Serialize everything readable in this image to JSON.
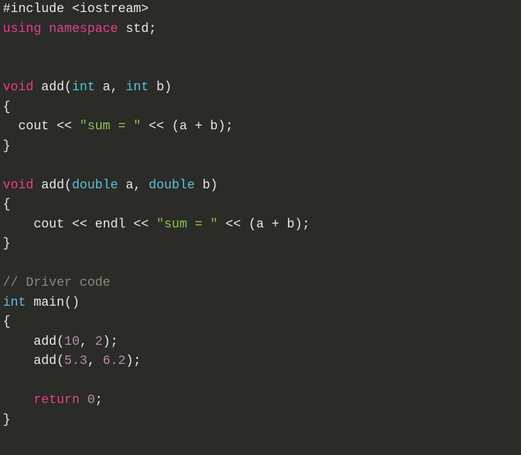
{
  "code": {
    "lang": "cpp",
    "tokens": [
      [
        {
          "t": "#include <iostream>",
          "c": "tok-prep"
        }
      ],
      [
        {
          "t": "using",
          "c": "tok-key"
        },
        {
          "t": " ",
          "c": "tok-punc"
        },
        {
          "t": "namespace",
          "c": "tok-key"
        },
        {
          "t": " std;",
          "c": "tok-punc"
        }
      ],
      [],
      [],
      [
        {
          "t": "void",
          "c": "tok-key"
        },
        {
          "t": " add(",
          "c": "tok-punc"
        },
        {
          "t": "int",
          "c": "tok-bltin"
        },
        {
          "t": " a, ",
          "c": "tok-punc"
        },
        {
          "t": "int",
          "c": "tok-bltin"
        },
        {
          "t": " b)",
          "c": "tok-punc"
        }
      ],
      [
        {
          "t": "{",
          "c": "tok-punc"
        }
      ],
      [
        {
          "t": "  cout << ",
          "c": "tok-punc"
        },
        {
          "t": "\"sum = \"",
          "c": "tok-str"
        },
        {
          "t": " << (a + b);",
          "c": "tok-punc"
        }
      ],
      [
        {
          "t": "}",
          "c": "tok-punc"
        }
      ],
      [],
      [
        {
          "t": "void",
          "c": "tok-key"
        },
        {
          "t": " add(",
          "c": "tok-punc"
        },
        {
          "t": "double",
          "c": "tok-bltin"
        },
        {
          "t": " a, ",
          "c": "tok-punc"
        },
        {
          "t": "double",
          "c": "tok-bltin"
        },
        {
          "t": " b)",
          "c": "tok-punc"
        }
      ],
      [
        {
          "t": "{",
          "c": "tok-punc"
        }
      ],
      [
        {
          "t": "    cout << endl << ",
          "c": "tok-punc"
        },
        {
          "t": "\"sum = \"",
          "c": "tok-str"
        },
        {
          "t": " << (a + b);",
          "c": "tok-punc"
        }
      ],
      [
        {
          "t": "}",
          "c": "tok-punc"
        }
      ],
      [],
      [
        {
          "t": "// Driver code",
          "c": "tok-cmt"
        }
      ],
      [
        {
          "t": "int",
          "c": "tok-bltin"
        },
        {
          "t": " main()",
          "c": "tok-punc"
        }
      ],
      [
        {
          "t": "{",
          "c": "tok-punc"
        }
      ],
      [
        {
          "t": "    add(",
          "c": "tok-punc"
        },
        {
          "t": "10",
          "c": "tok-num"
        },
        {
          "t": ", ",
          "c": "tok-punc"
        },
        {
          "t": "2",
          "c": "tok-num"
        },
        {
          "t": ");",
          "c": "tok-punc"
        }
      ],
      [
        {
          "t": "    add(",
          "c": "tok-punc"
        },
        {
          "t": "5.3",
          "c": "tok-num"
        },
        {
          "t": ", ",
          "c": "tok-punc"
        },
        {
          "t": "6.2",
          "c": "tok-num"
        },
        {
          "t": ");",
          "c": "tok-punc"
        }
      ],
      [],
      [
        {
          "t": "    ",
          "c": "tok-punc"
        },
        {
          "t": "return",
          "c": "tok-key"
        },
        {
          "t": " ",
          "c": "tok-punc"
        },
        {
          "t": "0",
          "c": "tok-num"
        },
        {
          "t": ";",
          "c": "tok-punc"
        }
      ],
      [
        {
          "t": "}",
          "c": "tok-punc"
        }
      ]
    ]
  }
}
